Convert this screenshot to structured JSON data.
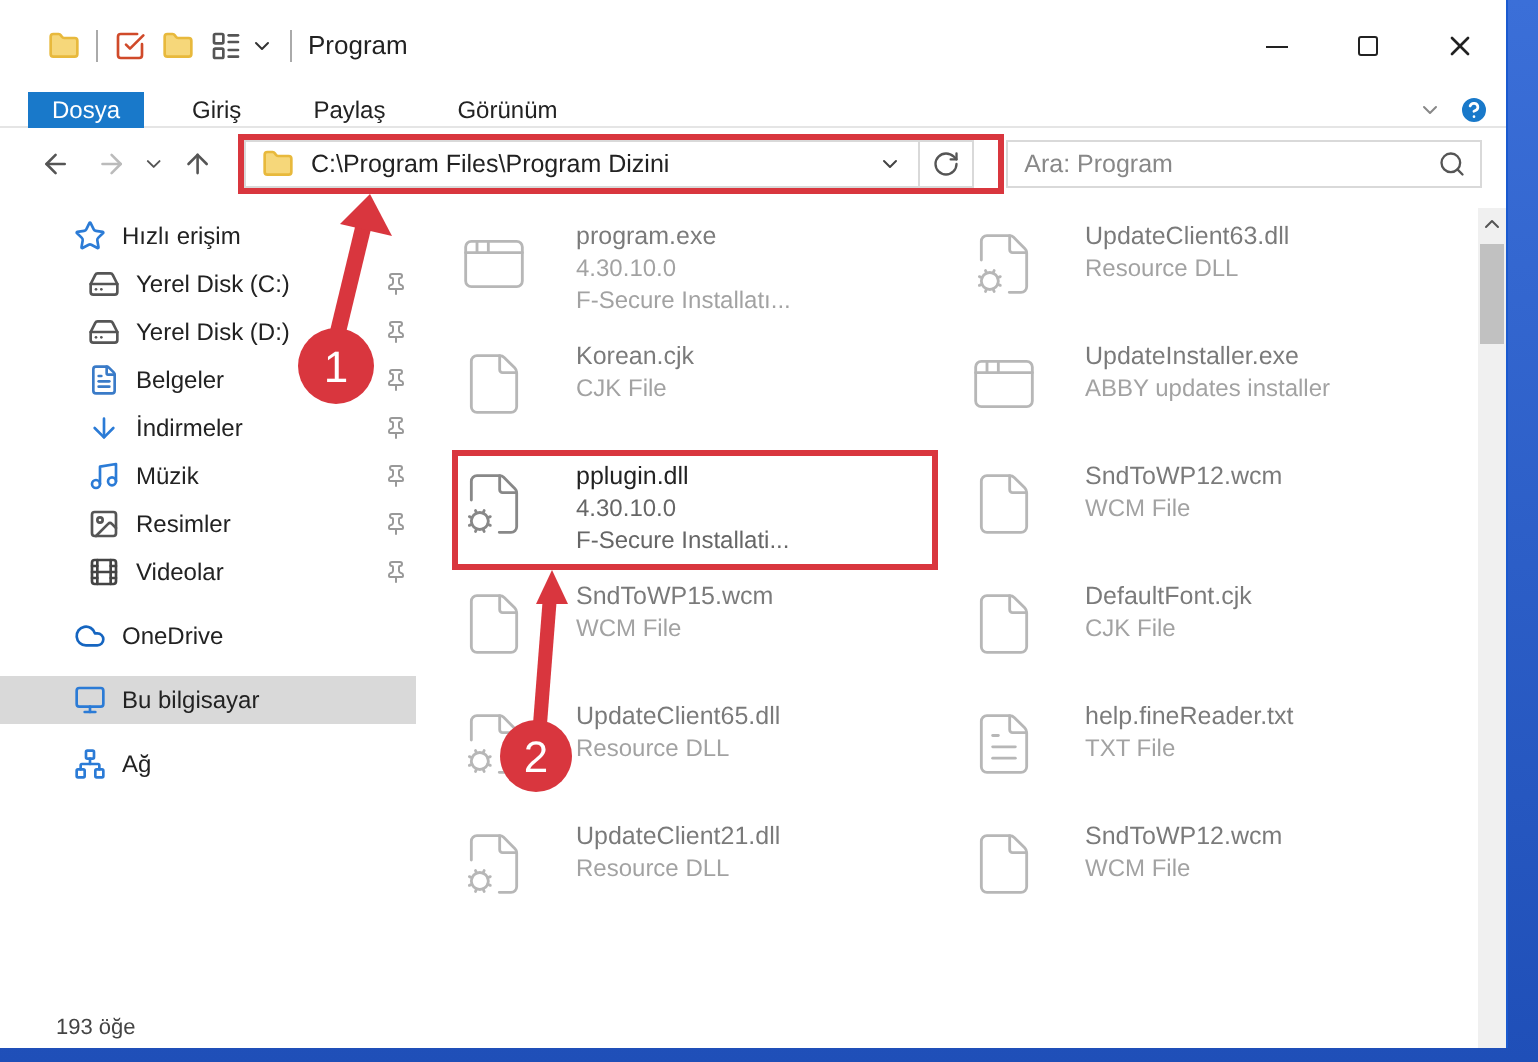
{
  "window": {
    "title": "Program"
  },
  "ribbon_tabs": [
    {
      "label": "Dosya",
      "selected": true
    },
    {
      "label": "Giriş",
      "selected": false
    },
    {
      "label": "Paylaş",
      "selected": false
    },
    {
      "label": "Görünüm",
      "selected": false
    }
  ],
  "address_bar": {
    "path": "C:\\Program Files\\Program Dizini"
  },
  "search": {
    "placeholder": "Ara: Program"
  },
  "sidebar": {
    "items": [
      {
        "label": "Hızlı erişim",
        "kind": "quick",
        "selected": false,
        "children": [
          {
            "label": "Yerel Disk (C:)",
            "kind": "disk-c",
            "pinned": true
          },
          {
            "label": "Yerel Disk (D:)",
            "kind": "disk",
            "pinned": true
          },
          {
            "label": "Belgeler",
            "kind": "docs",
            "pinned": true
          },
          {
            "label": "İndirmeler",
            "kind": "downloads",
            "pinned": true
          },
          {
            "label": "Müzik",
            "kind": "music",
            "pinned": true
          },
          {
            "label": "Resimler",
            "kind": "pictures",
            "pinned": true
          },
          {
            "label": "Videolar",
            "kind": "videos",
            "pinned": true
          }
        ]
      },
      {
        "label": "OneDrive",
        "kind": "cloud",
        "selected": false
      },
      {
        "label": "Bu bilgisayar",
        "kind": "pc",
        "selected": true
      },
      {
        "label": "Ağ",
        "kind": "network",
        "selected": false
      }
    ]
  },
  "files": [
    {
      "name": "program.exe",
      "details": [
        "4.30.10.0",
        "F-Secure Installatı..."
      ],
      "kind": "app",
      "dimmed": true
    },
    {
      "name": "UpdateClient63.dll",
      "details": [
        "Resource DLL"
      ],
      "kind": "dll",
      "dimmed": true
    },
    {
      "name": "Korean.cjk",
      "details": [
        "CJK File"
      ],
      "kind": "file",
      "dimmed": true
    },
    {
      "name": "UpdateInstaller.exe",
      "details": [
        "ABBY updates installer"
      ],
      "kind": "installer",
      "dimmed": true
    },
    {
      "name": "pplugin.dll",
      "details": [
        "4.30.10.0",
        "F-Secure Installati..."
      ],
      "kind": "dll",
      "dimmed": false
    },
    {
      "name": "SndToWP12.wcm",
      "details": [
        "WCM File"
      ],
      "kind": "file",
      "dimmed": true
    },
    {
      "name": "SndToWP15.wcm",
      "details": [
        "WCM File"
      ],
      "kind": "file",
      "dimmed": true
    },
    {
      "name": "DefaultFont.cjk",
      "details": [
        "CJK File"
      ],
      "kind": "file",
      "dimmed": true
    },
    {
      "name": "UpdateClient65.dll",
      "details": [
        "Resource DLL"
      ],
      "kind": "dll",
      "dimmed": true
    },
    {
      "name": "help.fineReader.txt",
      "details": [
        "TXT File"
      ],
      "kind": "text",
      "dimmed": true
    },
    {
      "name": "UpdateClient21.dll",
      "details": [
        "Resource DLL"
      ],
      "kind": "dll",
      "dimmed": true
    },
    {
      "name": "SndToWP12.wcm",
      "details": [
        "WCM File"
      ],
      "kind": "file",
      "dimmed": true
    }
  ],
  "status_bar": {
    "count": "193 öğe"
  },
  "callouts": [
    {
      "number": "1"
    },
    {
      "number": "2"
    }
  ]
}
